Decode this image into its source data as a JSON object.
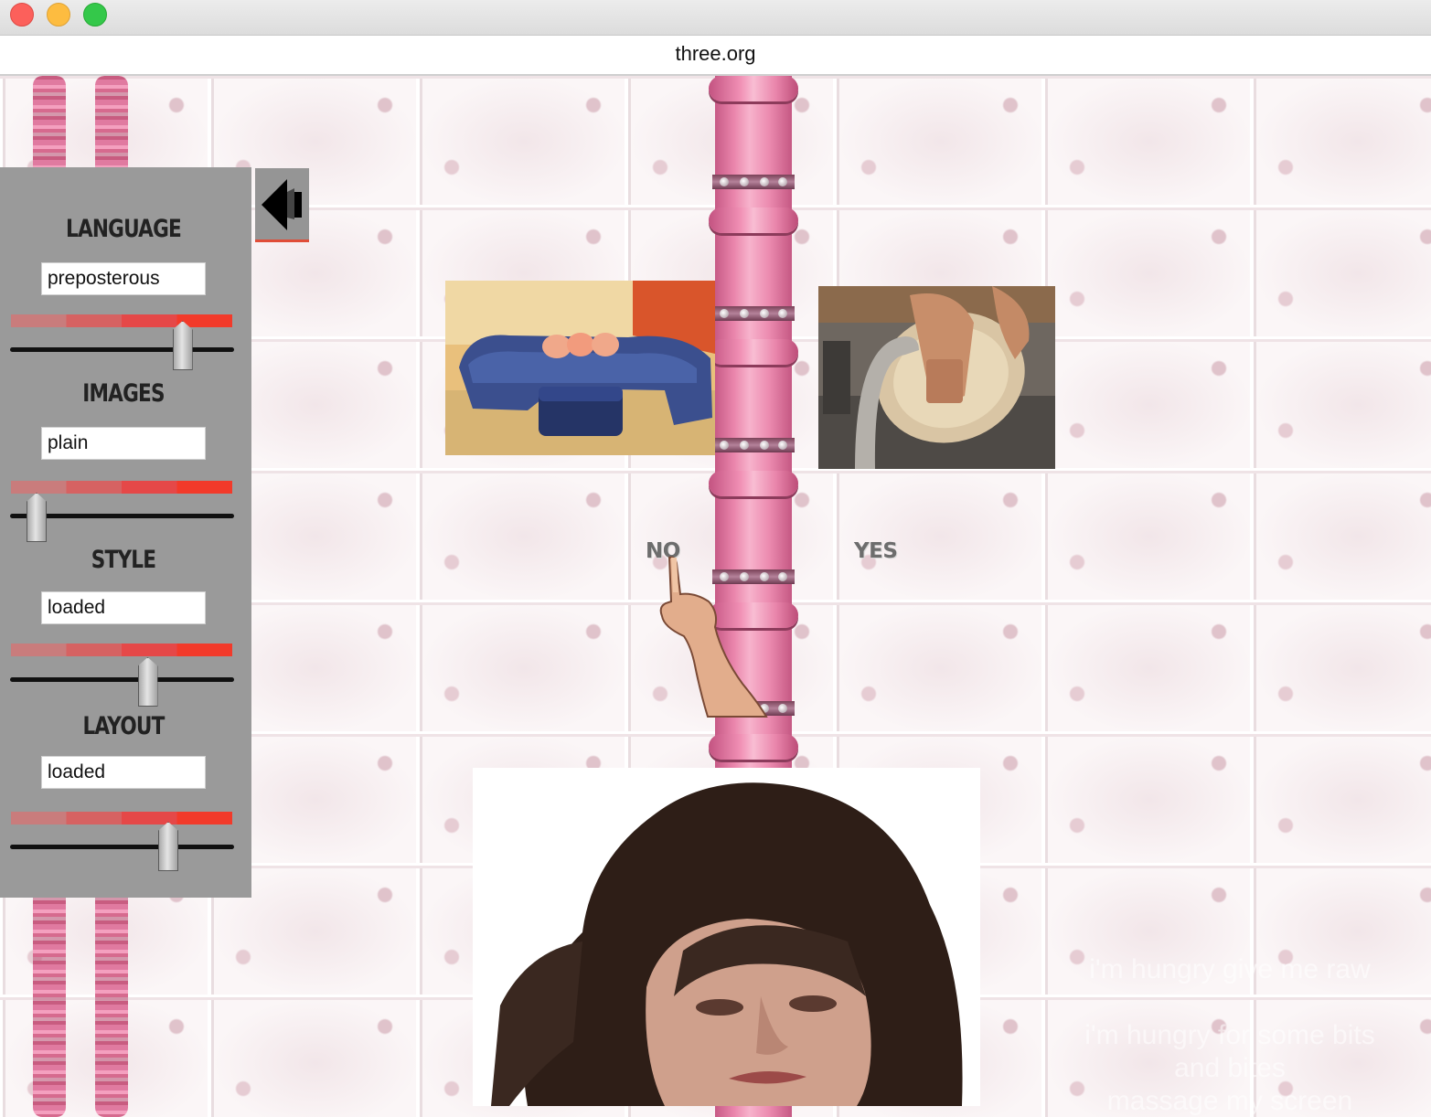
{
  "window": {
    "url": "three.org"
  },
  "sidebar": {
    "sections": [
      {
        "label": "LANGUAGE",
        "value": "preposterous"
      },
      {
        "label": "IMAGES",
        "value": "plain"
      },
      {
        "label": "STYLE",
        "value": "loaded"
      },
      {
        "label": "LAYOUT",
        "value": "loaded"
      }
    ],
    "slider_levels": {
      "language": 0.79,
      "images": 0.08,
      "style": 0.62,
      "layout": 0.72
    },
    "meter_colors": [
      "#c97c7c",
      "#d66262",
      "#e54848",
      "#f23a2a"
    ]
  },
  "content": {
    "choices": {
      "no": "NO",
      "yes": "YES"
    },
    "ghost_lines": [
      "i'm hungry give me raw",
      "i'm hungry for some bits",
      "and bites",
      "massage my screen"
    ]
  },
  "icons": {
    "back": "back-arrow-icon",
    "pointer": "pointing-hand"
  },
  "colors": {
    "panel_bg": "#9a9a9a",
    "pipe": "#ea86ac",
    "accent": "#e04d38"
  }
}
